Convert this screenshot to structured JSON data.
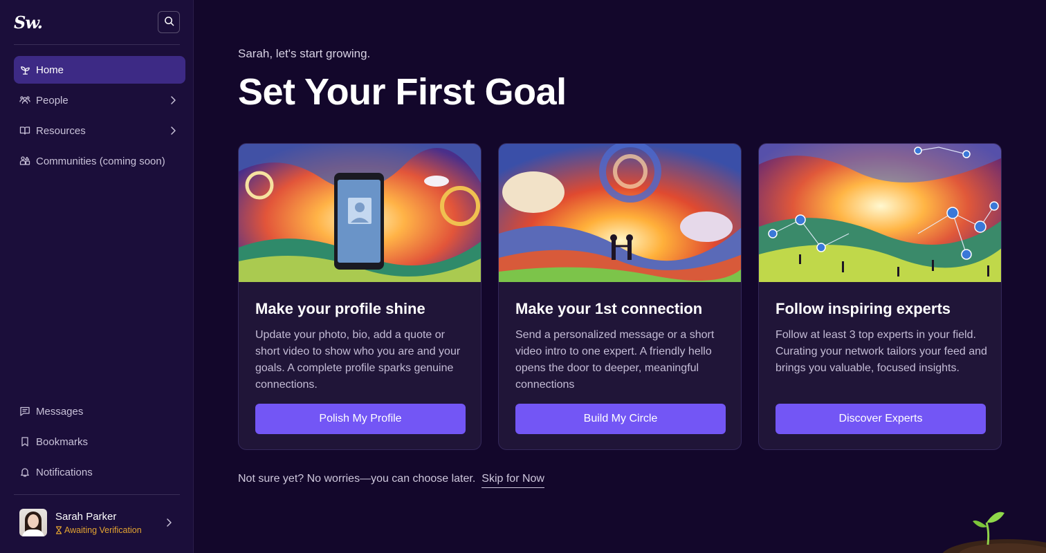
{
  "app": {
    "logo_text": "Sw."
  },
  "sidebar": {
    "nav": [
      {
        "label": "Home",
        "icon": "sprout-icon",
        "active": true
      },
      {
        "label": "People",
        "icon": "people-icon"
      },
      {
        "label": "Resources",
        "icon": "book-icon"
      },
      {
        "label": "Communities (coming soon)",
        "icon": "communities-icon"
      }
    ],
    "bottom_nav": [
      {
        "label": "Messages",
        "icon": "message-icon"
      },
      {
        "label": "Bookmarks",
        "icon": "bookmark-icon"
      },
      {
        "label": "Notifications",
        "icon": "bell-icon"
      }
    ],
    "user": {
      "name": "Sarah Parker",
      "status": "Awaiting Verification"
    }
  },
  "main": {
    "greeting": "Sarah, let's start growing.",
    "title": "Set Your First Goal",
    "cards": [
      {
        "title": "Make your profile shine",
        "description": "Update your photo, bio, add a quote or short video to show who you are and your goals. A complete profile sparks genuine connections.",
        "button": "Polish My Profile"
      },
      {
        "title": "Make your 1st connection",
        "description": "Send a personalized message or a short video intro to one expert. A friendly hello opens the door to deeper, meaningful connections",
        "button": "Build My Circle"
      },
      {
        "title": "Follow inspiring experts",
        "description": "Follow at least 3 top experts in your field. Curating your network tailors your feed and brings you valuable, focused insights.",
        "button": "Discover Experts"
      }
    ],
    "footer_note": "Not sure yet? No worries—you can choose later.",
    "skip_label": "Skip for Now"
  },
  "colors": {
    "background": "#13072b",
    "sidebar": "#1b0e3a",
    "accent": "#7356f5",
    "active_nav": "#3d2a85",
    "status": "#e5a531"
  }
}
